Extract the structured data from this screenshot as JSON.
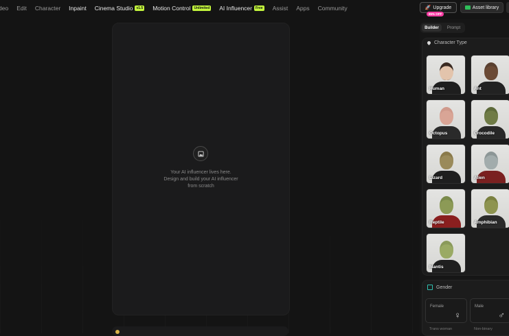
{
  "nav": {
    "items": [
      {
        "label": "deo",
        "bright": false
      },
      {
        "label": "Edit",
        "bright": false
      },
      {
        "label": "Character",
        "bright": false
      },
      {
        "label": "Inpaint",
        "bright": true
      },
      {
        "label": "Cinema Studio",
        "bright": true,
        "badge": "v1.5"
      },
      {
        "label": "Motion Control",
        "bright": true,
        "badge": "Unlimited"
      },
      {
        "label": "AI Influencer",
        "bright": true,
        "badge": "Free"
      },
      {
        "label": "Assist",
        "bright": false
      },
      {
        "label": "Apps",
        "bright": false
      },
      {
        "label": "Community",
        "bright": false
      }
    ],
    "upgrade_label": "Upgrade",
    "upgrade_badge": "85% OFF",
    "asset_library_label": "Asset library"
  },
  "canvas": {
    "line1": "Your AI influencer lives here.",
    "line2": "Design and build your AI influencer",
    "line3": "from scratch"
  },
  "panel": {
    "tabs": [
      {
        "label": "Builder",
        "active": true
      },
      {
        "label": "Prompt",
        "active": false
      }
    ],
    "character_type_title": "Character Type",
    "characters": [
      {
        "label": "Human",
        "head": "#3a2a22",
        "body": "#1e1e1e",
        "skin": "#e3c4ac"
      },
      {
        "label": "Ant",
        "head": "#5a4030",
        "body": "#222222",
        "skin": "#6b4a35"
      },
      {
        "label": "Octopus",
        "head": "#d09a8c",
        "body": "#2a2a2a",
        "skin": "#d9a596"
      },
      {
        "label": "Crocodile",
        "head": "#5d6a3a",
        "body": "#282828",
        "skin": "#6f7b46"
      },
      {
        "label": "Lizard",
        "head": "#8a7a4a",
        "body": "#1e1e1e",
        "skin": "#9a8a5a"
      },
      {
        "label": "Alien",
        "head": "#8c9696",
        "body": "#7a2020",
        "skin": "#a2acac"
      },
      {
        "label": "Reptile",
        "head": "#7a8a4a",
        "body": "#8a1f1f",
        "skin": "#8c9a56"
      },
      {
        "label": "Amphibian",
        "head": "#7a8040",
        "body": "#2a2a2a",
        "skin": "#8e9450"
      },
      {
        "label": "Mantis",
        "head": "#8a9a5a",
        "body": "#1f1f1f",
        "skin": "#9aaa64"
      }
    ],
    "gender_title": "Gender",
    "genders": [
      {
        "label": "Female",
        "symbol": "♀"
      },
      {
        "label": "Male",
        "symbol": "♂"
      }
    ],
    "gender_row2": [
      "Trans woman",
      "Non-binary"
    ]
  }
}
